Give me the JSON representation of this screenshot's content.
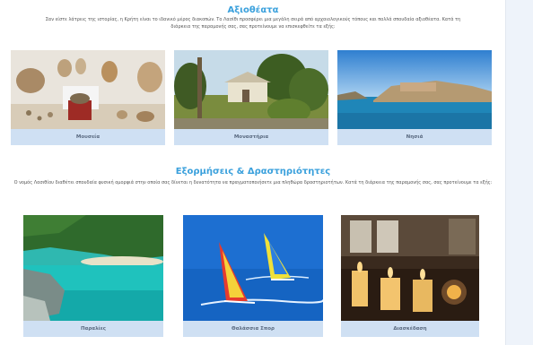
{
  "sights": {
    "title": "Αξιοθέατα",
    "description": "Σαν είστε λάτρεις της ιστορίας, η Κρήτη είναι το ιδανικό μέρος διακοπών. Το Λασίθι προσφέρει μια μεγάλη σειρά από αρχαιολογικούς τόπους και πολλά σπουδαία αξιοθέατα. Κατά τη διάρκεια της παραμονής σας, σας προτείνουμε να επισκεφθείτε τα εξής:",
    "cards": [
      {
        "label": "Μουσεία",
        "icon": "museum-pottery-image"
      },
      {
        "label": "Μοναστήρια",
        "icon": "monastery-image"
      },
      {
        "label": "Νησιά",
        "icon": "island-fortress-image"
      }
    ]
  },
  "activities": {
    "title": "Εξορμήσεις & Δραστηριότητες",
    "description": "Ο νομός Λασιθίου διαθέτει σπουδαία φυσική ομορφιά στην οποία σας δίνεται η δυνατότητα να πραγματοποιήσετε μια πληθώρα δραστηριοτήτων. Κατά τη διάρκεια της παραμονής σας, σας προτείνουμε τα εξής:",
    "cards": [
      {
        "label": "Παραλίες",
        "icon": "beach-image"
      },
      {
        "label": "Θαλάσσια Σπορ",
        "icon": "windsurf-image"
      },
      {
        "label": "Διασκέδαση",
        "icon": "dining-candles-image"
      }
    ]
  }
}
